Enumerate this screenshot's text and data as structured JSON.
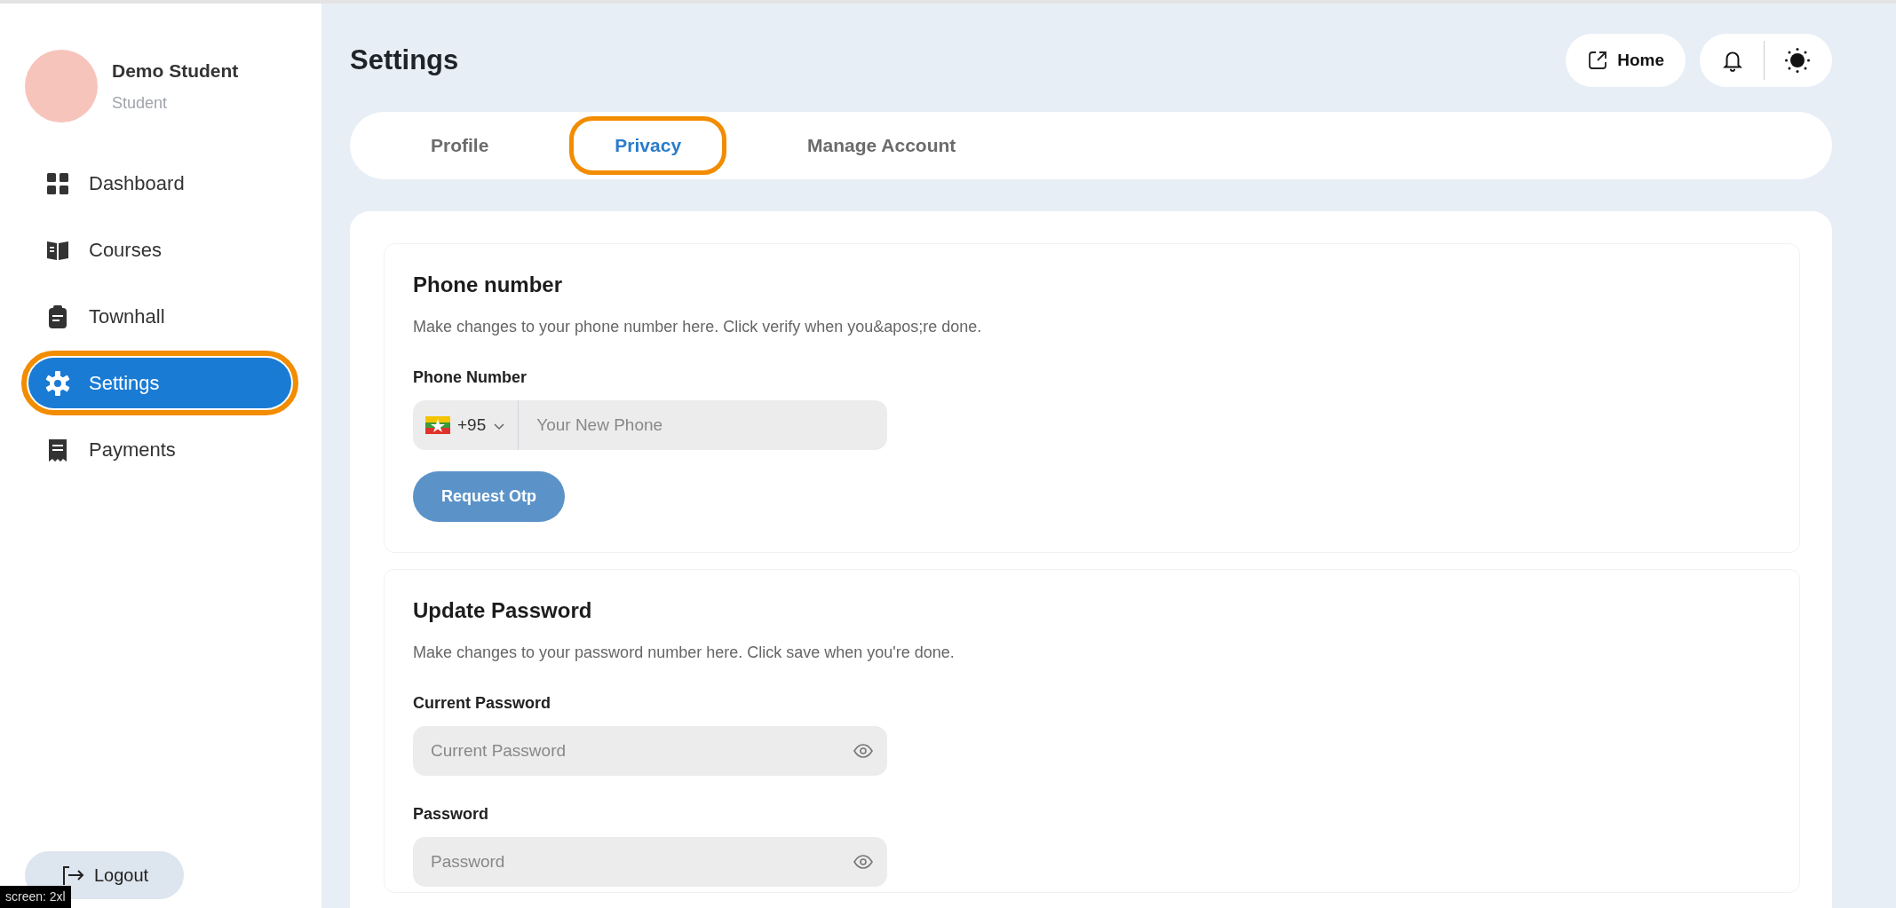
{
  "sidebar": {
    "user": {
      "name": "Demo Student",
      "role": "Student"
    },
    "items": [
      {
        "label": "Dashboard",
        "selected": false,
        "highlighted": false
      },
      {
        "label": "Courses",
        "selected": false,
        "highlighted": false
      },
      {
        "label": "Townhall",
        "selected": false,
        "highlighted": false
      },
      {
        "label": "Settings",
        "selected": true,
        "highlighted": true
      },
      {
        "label": "Payments",
        "selected": false,
        "highlighted": false
      }
    ],
    "logout": "Logout"
  },
  "header": {
    "title": "Settings",
    "home": "Home"
  },
  "tabs": [
    {
      "label": "Profile",
      "selected": false,
      "highlighted": false
    },
    {
      "label": "Privacy",
      "selected": true,
      "highlighted": true
    },
    {
      "label": "Manage Account",
      "selected": false,
      "highlighted": false
    }
  ],
  "sections": [
    {
      "title": "Phone number",
      "description": "Make changes to your phone number here. Click verify when you&apos;re done.",
      "fields": [
        {
          "kind": "phone",
          "label": "Phone Number",
          "code": "+95",
          "placeholder": "Your New Phone"
        }
      ],
      "button": "Request Otp"
    },
    {
      "title": "Update Password",
      "description": "Make changes to your password number here. Click save when you're done.",
      "fields": [
        {
          "kind": "password",
          "label": "Current Password",
          "placeholder": "Current Password"
        },
        {
          "kind": "password",
          "label": "Password",
          "placeholder": "Password"
        }
      ]
    }
  ],
  "screen_badge": "screen: 2xl"
}
